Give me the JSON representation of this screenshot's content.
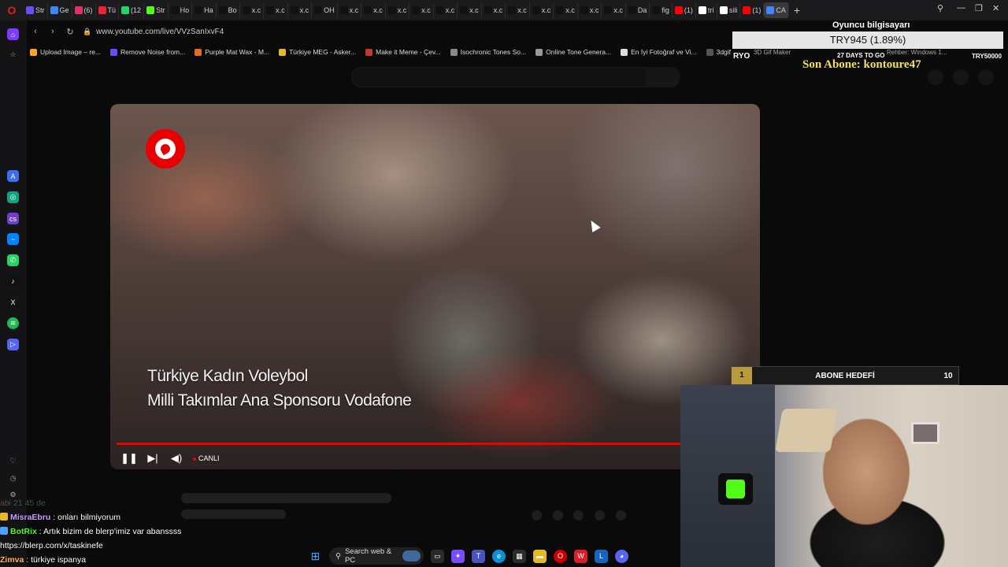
{
  "tabs": [
    {
      "label": "Str",
      "color": "#6b4cff"
    },
    {
      "label": "Ge",
      "color": "#4285f4"
    },
    {
      "label": "(6)",
      "color": "#e1306c"
    },
    {
      "label": "Tü",
      "color": "#e23"
    },
    {
      "label": "(12",
      "color": "#25d366"
    },
    {
      "label": "Str",
      "color": "#53fc18"
    },
    {
      "label": "Ho",
      "color": "#111"
    },
    {
      "label": "Ha",
      "color": "#111"
    },
    {
      "label": "Bo",
      "color": "#111"
    },
    {
      "label": "x.c",
      "color": "#111"
    },
    {
      "label": "x.c",
      "color": "#111"
    },
    {
      "label": "x.c",
      "color": "#111"
    },
    {
      "label": "OH",
      "color": "#111"
    },
    {
      "label": "x.c",
      "color": "#111"
    },
    {
      "label": "x.c",
      "color": "#111"
    },
    {
      "label": "x.c",
      "color": "#111"
    },
    {
      "label": "x.c",
      "color": "#111"
    },
    {
      "label": "x.c",
      "color": "#111"
    },
    {
      "label": "x.c",
      "color": "#111"
    },
    {
      "label": "x.c",
      "color": "#111"
    },
    {
      "label": "x.c",
      "color": "#111"
    },
    {
      "label": "x.c",
      "color": "#111"
    },
    {
      "label": "x.c",
      "color": "#111"
    },
    {
      "label": "x.c",
      "color": "#111"
    },
    {
      "label": "x.c",
      "color": "#111"
    },
    {
      "label": "Da",
      "color": "#111"
    },
    {
      "label": "fig",
      "color": "#111"
    },
    {
      "label": "(1)",
      "color": "#f00"
    },
    {
      "label": "trí",
      "color": "#fff"
    },
    {
      "label": "sili",
      "color": "#fff"
    },
    {
      "label": "(1)",
      "color": "#f00"
    },
    {
      "label": "CA",
      "color": "#4285f4",
      "active": true
    }
  ],
  "address": {
    "url": "www.youtube.com/live/VVzSanIxvF4"
  },
  "bookmarks": [
    {
      "label": "Upload Image – re...",
      "color": "#f5a623"
    },
    {
      "label": "Remove Noise from...",
      "color": "#6b4cff"
    },
    {
      "label": "Purple Mat Wax - M...",
      "color": "#e86c1f"
    },
    {
      "label": "Türkiye MEG - Asker...",
      "color": "#e8b923"
    },
    {
      "label": "Make it Meme - Çev...",
      "color": "#c0392b"
    },
    {
      "label": "Isochronic Tones So...",
      "color": "#888"
    },
    {
      "label": "Online Tone Genera...",
      "color": "#999"
    },
    {
      "label": "En İyi Fotoğraf ve Vi...",
      "color": "#ddd"
    },
    {
      "label": "3dgifmaker28349.gi...",
      "color": "#555"
    }
  ],
  "video": {
    "caption1": "Türkiye Kadın Voleybol",
    "caption2": "Milli Takımlar Ana Sponsoru Vodafone",
    "live_label": "CANLI",
    "progress": 1.0
  },
  "overlays": {
    "player_info_title": "Oyuncu bilgisayarı",
    "price": "TRY945 (1.89%)",
    "ryo": "RYO",
    "days_to_go": "27 DAYS TO GO",
    "try_goal": "TRY50000",
    "son_abone": "Son Abone: kontoure47",
    "hedef_current": "1",
    "hedef_label": "ABONE HEDEFİ",
    "hedef_goal": "10",
    "peek_labels": [
      "3D Gif Maker",
      "Multi TV - B haber K...",
      "Rehber: Windows 1..."
    ]
  },
  "chat": [
    {
      "user": "",
      "text": "abi 21 45 de",
      "faded": true
    },
    {
      "user": "MisraEbru",
      "text": " : onları bilmiyorum",
      "color": "#c89cff",
      "badge": "#e8b923"
    },
    {
      "user": "BotRix",
      "text": " : Artık bizim de blerp'imiz var abanssss",
      "color": "#53fc18",
      "badge": "#4aa3ff"
    },
    {
      "user": "",
      "text": "https://blerp.com/x/taskinefe",
      "color": "#fff"
    },
    {
      "user": "Zimva",
      "text": " : türkiye ispanya",
      "color": "#ffb24a"
    }
  ],
  "taskbar": {
    "search_label": "Search web & PC"
  },
  "colors": {
    "accent_red": "#e60000",
    "kick_green": "#53fc18",
    "goal_gold": "#b99a3d"
  }
}
